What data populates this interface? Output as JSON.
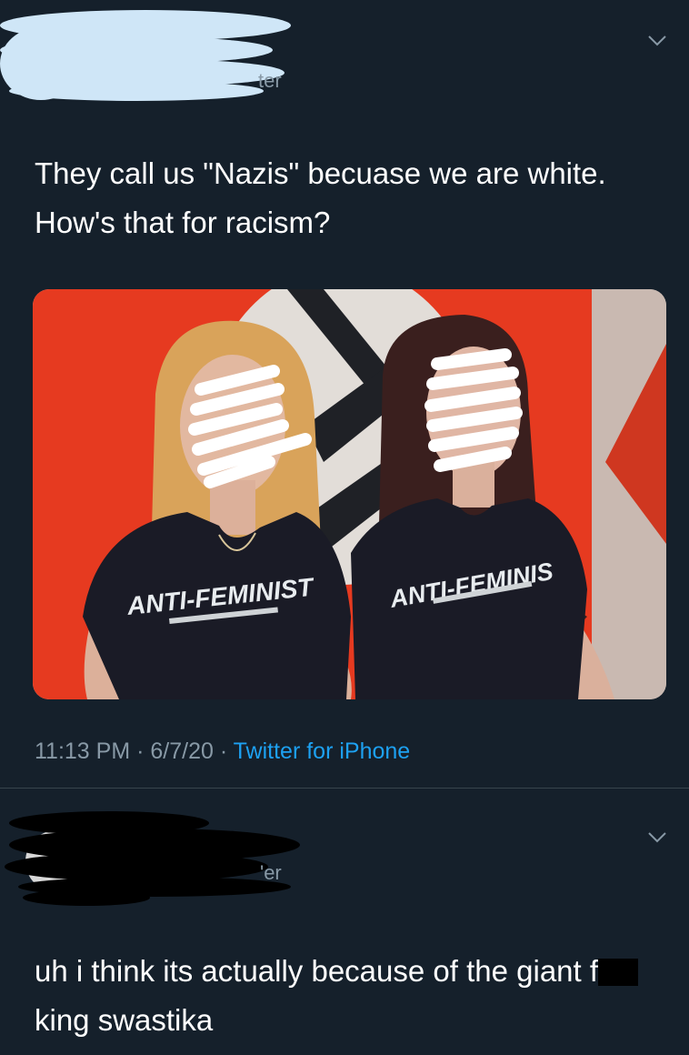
{
  "tweet": {
    "handle_suffix": "ter",
    "text": "They call us \"Nazis\" becuase we are white. How's that for racism?",
    "media": {
      "shirt_left": "ANTI-FEMINIST",
      "shirt_right": "ANTI-FEMINIS"
    },
    "time": "11:13 PM",
    "separator": " · ",
    "date": "6/7/20",
    "client": "Twitter for iPhone"
  },
  "reply": {
    "handle_suffix": "'er",
    "text_part1": "uh i think its actually because of the giant f",
    "text_part2": "king swastika"
  },
  "colors": {
    "background": "#15202b",
    "divider": "#38444d",
    "secondary_text": "#8899a6",
    "link_blue": "#1da1f2",
    "flag_red": "#e63a20"
  },
  "icons": {
    "caret": "chevron-down-icon"
  }
}
